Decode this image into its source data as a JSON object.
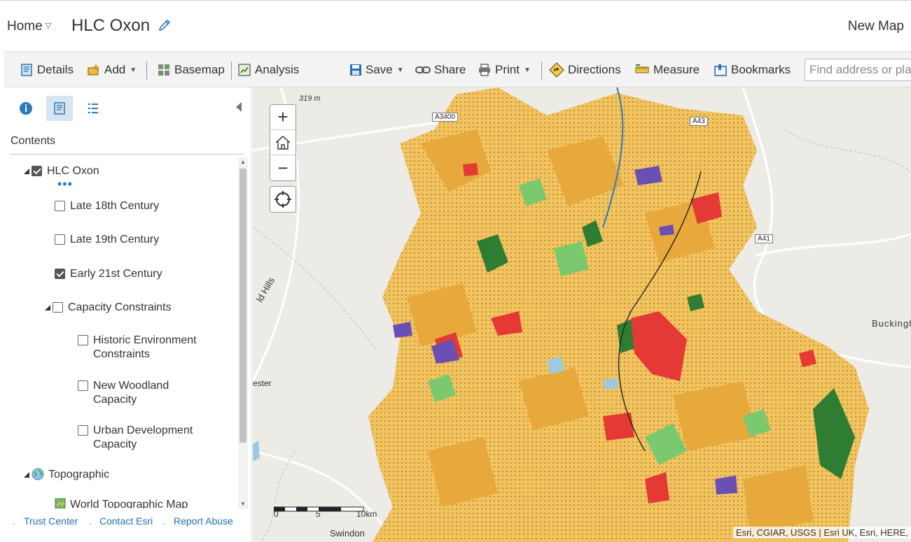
{
  "header": {
    "home_label": "Home",
    "map_title": "HLC Oxon",
    "new_map_label": "New Map"
  },
  "toolbar": {
    "details": "Details",
    "add": "Add",
    "basemap": "Basemap",
    "analysis": "Analysis",
    "save": "Save",
    "share": "Share",
    "print": "Print",
    "directions": "Directions",
    "measure": "Measure",
    "bookmarks": "Bookmarks",
    "search_placeholder": "Find address or place"
  },
  "panel": {
    "contents_heading": "Contents",
    "layers": [
      {
        "label": "HLC Oxon",
        "checked": true
      },
      {
        "label": "Late 18th Century",
        "checked": false
      },
      {
        "label": "Late 19th Century",
        "checked": false
      },
      {
        "label": "Early 21st Century",
        "checked": true
      },
      {
        "label": "Capacity Constraints",
        "checked": false
      },
      {
        "label": "Historic Environment Constraints",
        "checked": false
      },
      {
        "label": "New Woodland Capacity",
        "checked": false
      },
      {
        "label": "Urban Development Capacity",
        "checked": false
      },
      {
        "label": "Topographic"
      },
      {
        "label": "World Topographic Map"
      }
    ],
    "footer": {
      "trust_center": "Trust Center",
      "contact_esri": "Contact Esri",
      "report_abuse": "Report Abuse"
    }
  },
  "map": {
    "labels": {
      "elevation": "319 m",
      "hills": "ld Hills",
      "chester": "ester",
      "buckingham": "Buckingh",
      "swindon": "Swindon"
    },
    "roads": {
      "a3400": "A3400",
      "a43": "A43",
      "a41": "A41"
    },
    "scale": {
      "t0": "0",
      "t5": "5",
      "t10": "10km"
    },
    "attribution": "Esri, CGIAR, USGS | Esri UK, Esri, HERE,",
    "colors": {
      "arable": "#f3c35e",
      "pasture": "#e8a93c",
      "woodland": "#2e7d32",
      "grass": "#7bc96f",
      "urban": "#e53935",
      "industrial": "#6a4fb5",
      "water": "#9ec9e2",
      "basemap": "#ecebe6"
    }
  }
}
